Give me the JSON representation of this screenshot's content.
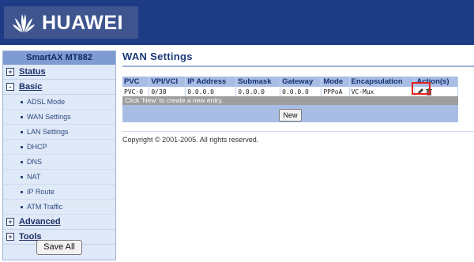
{
  "brand": {
    "name": "HUAWEI",
    "icon": "huawei-flower-logo",
    "colors": {
      "header": "#1e3b86",
      "table_header": "#a7bde4",
      "highlight": "#e2211c"
    }
  },
  "sidebar": {
    "model": "SmartAX MT882",
    "sections": [
      {
        "label": "Status",
        "expander": "+"
      },
      {
        "label": "Basic",
        "expander": "-"
      }
    ],
    "items": [
      "ADSL Mode",
      "WAN Settings",
      "LAN Settings",
      "DHCP",
      "DNS",
      "NAT",
      "IP Route",
      "ATM Traffic"
    ],
    "sections_after": [
      {
        "label": "Advanced",
        "expander": "+"
      },
      {
        "label": "Tools",
        "expander": "+"
      }
    ],
    "save_label": "Save All"
  },
  "main": {
    "title": "WAN Settings",
    "columns": [
      "PVC",
      "VPI/VCI",
      "IP Address",
      "Submask",
      "Gateway",
      "Mode",
      "Encapsulation",
      "Action(s)"
    ],
    "row": [
      "PVC-0",
      "0/38",
      "0.0.0.0",
      "0.0.0.0",
      "0.0.0.0",
      "PPPoA",
      "VC-Mux"
    ],
    "action_icons": [
      "edit-icon",
      "delete-icon"
    ],
    "info": "Click 'New' to create a new entry.",
    "new_label": "New",
    "copyright": "Copyright © 2001-2005. All rights reserved."
  }
}
